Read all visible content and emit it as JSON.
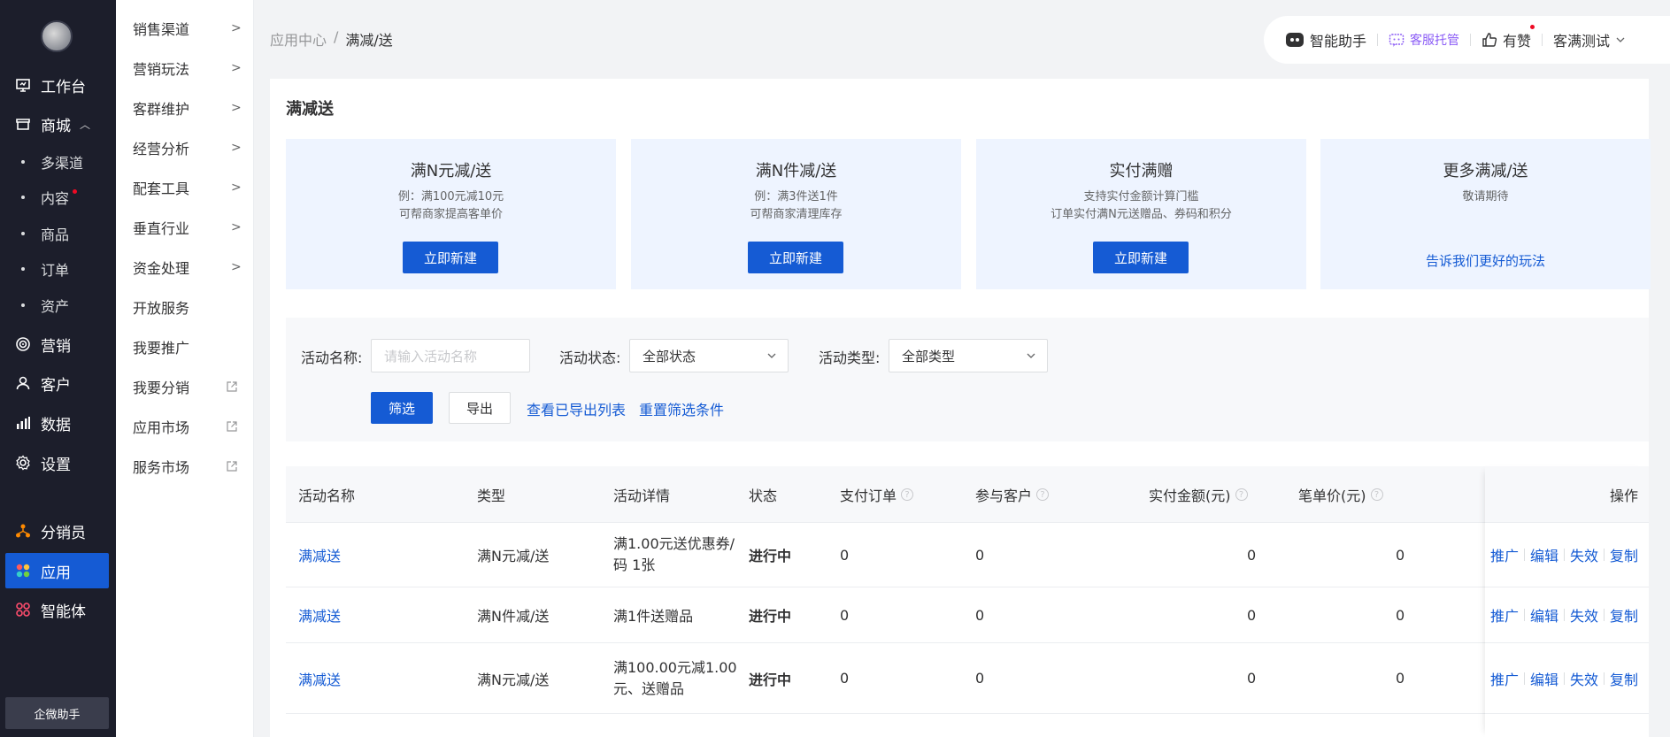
{
  "sidebar": {
    "items": [
      {
        "label": "工作台",
        "icon": "workbench-icon"
      },
      {
        "label": "商城",
        "icon": "shop-icon"
      },
      {
        "label": "营销",
        "icon": "marketing-icon"
      },
      {
        "label": "客户",
        "icon": "customer-icon"
      },
      {
        "label": "数据",
        "icon": "data-icon"
      },
      {
        "label": "设置",
        "icon": "settings-icon"
      },
      {
        "label": "分销员",
        "icon": "distributor-icon"
      },
      {
        "label": "应用",
        "icon": "apps-icon"
      },
      {
        "label": "智能体",
        "icon": "agent-icon"
      }
    ],
    "shop_sub": [
      "多渠道",
      "内容",
      "商品",
      "订单",
      "资产"
    ],
    "ai_helper": "企微助手"
  },
  "sidebar2": {
    "items": [
      {
        "label": "销售渠道",
        "kind": "arrow"
      },
      {
        "label": "营销玩法",
        "kind": "arrow"
      },
      {
        "label": "客群维护",
        "kind": "arrow"
      },
      {
        "label": "经营分析",
        "kind": "arrow"
      },
      {
        "label": "配套工具",
        "kind": "arrow"
      },
      {
        "label": "垂直行业",
        "kind": "arrow"
      },
      {
        "label": "资金处理",
        "kind": "arrow"
      },
      {
        "label": "开放服务",
        "kind": "none"
      },
      {
        "label": "我要推广",
        "kind": "none"
      },
      {
        "label": "我要分销",
        "kind": "external"
      },
      {
        "label": "应用市场",
        "kind": "external"
      },
      {
        "label": "服务市场",
        "kind": "external"
      }
    ]
  },
  "breadcrumb": {
    "root": "应用中心",
    "sep": "/",
    "current": "满减/送"
  },
  "topbar": {
    "assistant": "智能助手",
    "kefu": "客服托管",
    "like": "有赞",
    "account": "客满测试"
  },
  "page": {
    "title": "满减送"
  },
  "cards": [
    {
      "title": "满N元减/送",
      "desc1": "例：满100元减10元",
      "desc2": "可帮商家提高客单价",
      "button": "立即新建"
    },
    {
      "title": "满N件减/送",
      "desc1": "例：满3件送1件",
      "desc2": "可帮商家清理库存",
      "button": "立即新建"
    },
    {
      "title": "实付满赠",
      "desc1": "支持实付金额计算门槛",
      "desc2": "订单实付满N元送赠品、券码和积分",
      "button": "立即新建"
    },
    {
      "title": "更多满减/送",
      "desc1": "敬请期待",
      "desc2": "",
      "link": "告诉我们更好的玩法"
    }
  ],
  "filter": {
    "name_label": "活动名称:",
    "name_placeholder": "请输入活动名称",
    "status_label": "活动状态:",
    "status_value": "全部状态",
    "type_label": "活动类型:",
    "type_value": "全部类型",
    "filter_button": "筛选",
    "export_button": "导出",
    "view_exports": "查看已导出列表",
    "reset": "重置筛选条件"
  },
  "table": {
    "columns": [
      "活动名称",
      "类型",
      "活动详情",
      "状态",
      "支付订单",
      "参与客户",
      "实付金额(元)",
      "笔单价(元)",
      "操作"
    ],
    "rows": [
      {
        "name": "满减送",
        "type": "满N元减/送",
        "detail": "满1.00元送优惠券/码 1张",
        "status": "进行中",
        "orders": "0",
        "customers": "0",
        "amount": "0",
        "unit_price": "0"
      },
      {
        "name": "满减送",
        "type": "满N件减/送",
        "detail": "满1件送赠品",
        "status": "进行中",
        "orders": "0",
        "customers": "0",
        "amount": "0",
        "unit_price": "0"
      },
      {
        "name": "满减送",
        "type": "满N元减/送",
        "detail": "满100.00元减1.00元、送赠品",
        "status": "进行中",
        "orders": "0",
        "customers": "0",
        "amount": "0",
        "unit_price": "0"
      }
    ],
    "actions": [
      "推广",
      "编辑",
      "失效",
      "复制"
    ]
  }
}
